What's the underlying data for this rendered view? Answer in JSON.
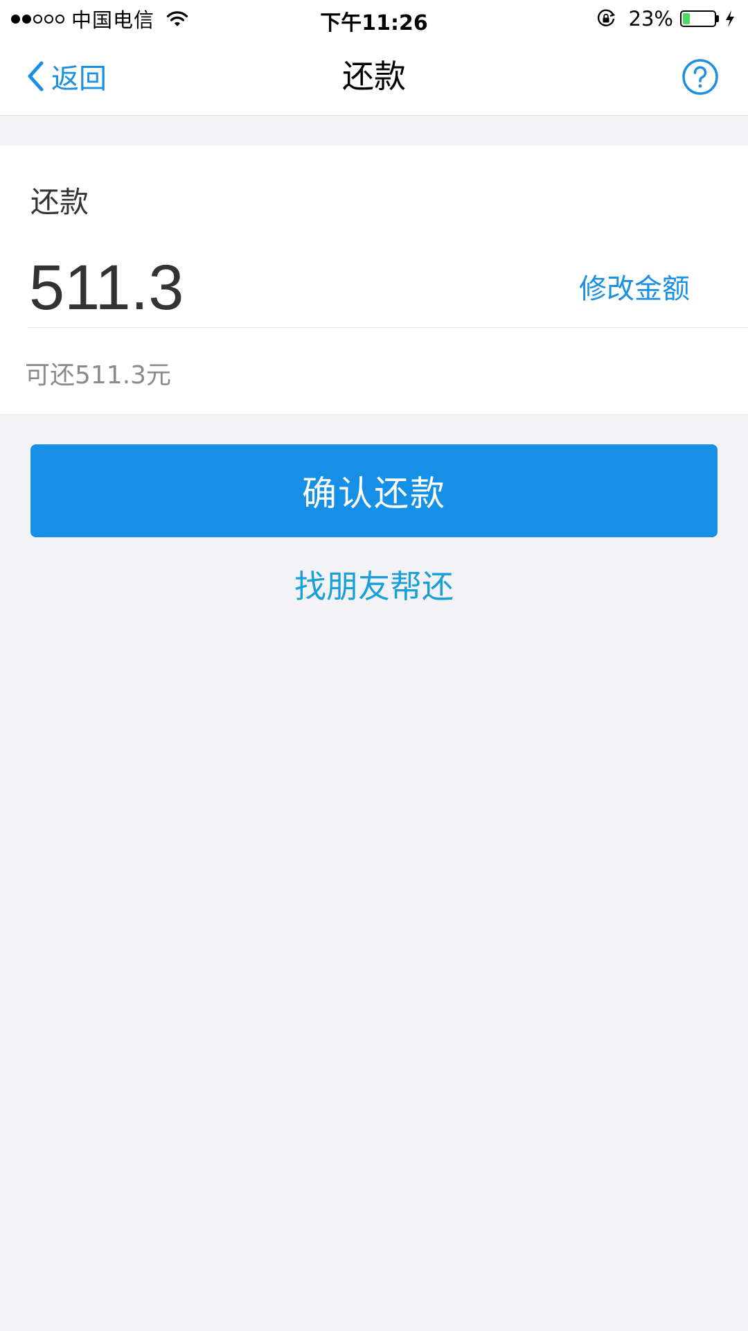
{
  "status_bar": {
    "carrier": "中国电信",
    "time": "下午11:26",
    "battery_percent": "23%",
    "battery_level": 0.23,
    "signal_bars_filled": 2,
    "signal_bars_total": 5,
    "battery_color": "#4cd964"
  },
  "nav": {
    "back_label": "返回",
    "title": "还款",
    "help_icon": "question-circle-icon",
    "accent_color": "#1a8fe3"
  },
  "repayment": {
    "label": "还款",
    "amount": "511.3",
    "edit_label": "修改金额",
    "available_text": "可还511.3元"
  },
  "actions": {
    "confirm_label": "确认还款",
    "friend_label": "找朋友帮还",
    "confirm_color": "#1690e6"
  }
}
